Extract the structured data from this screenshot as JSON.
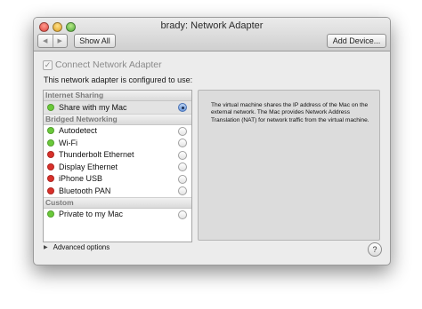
{
  "window": {
    "title": "brady: Network Adapter",
    "show_all_label": "Show All",
    "add_device_label": "Add Device...",
    "back_glyph": "◀",
    "forward_glyph": "▶"
  },
  "settings": {
    "connect_label": "Connect Network Adapter",
    "connect_checked": true,
    "connect_check_glyph": "✓",
    "configured_label": "This network adapter is configured to use:"
  },
  "groups": {
    "internet_sharing": "Internet Sharing",
    "bridged_networking": "Bridged Networking",
    "custom": "Custom"
  },
  "items": [
    {
      "label": "Share with my Mac",
      "status": "green",
      "selected": true
    },
    {
      "label": "Autodetect",
      "status": "green",
      "selected": false
    },
    {
      "label": "Wi-Fi",
      "status": "green",
      "selected": false
    },
    {
      "label": "Thunderbolt Ethernet",
      "status": "red",
      "selected": false
    },
    {
      "label": "Display Ethernet",
      "status": "red",
      "selected": false
    },
    {
      "label": "iPhone USB",
      "status": "red",
      "selected": false
    },
    {
      "label": "Bluetooth PAN",
      "status": "red",
      "selected": false
    },
    {
      "label": "Private to my Mac",
      "status": "green",
      "selected": false
    }
  ],
  "description": "The virtual machine shares the IP address of the Mac on the external network. The Mac provides Network Address Translation (NAT) for network traffic from the virtual machine.",
  "footer": {
    "advanced_label": "Advanced options",
    "disclosure_glyph": "▶",
    "help_glyph": "?"
  },
  "colors": {
    "status_green": "#6ac93a",
    "status_red": "#d9302a",
    "selection_radio": "#6b98da"
  }
}
